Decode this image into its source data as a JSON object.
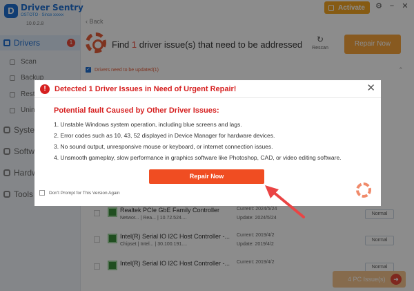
{
  "app": {
    "name": "Driver Sentry",
    "subtitle": "OSTOTO · Since xxxxx",
    "version": "10.0.2.8",
    "activate_label": "Activate"
  },
  "sidebar": {
    "drivers": {
      "label": "Drivers",
      "badge": "1"
    },
    "subitems": [
      {
        "label": "Scan"
      },
      {
        "label": "Backup"
      },
      {
        "label": "Rest"
      },
      {
        "label": "Unin"
      }
    ],
    "items": [
      {
        "label": "Systen"
      },
      {
        "label": "Softw"
      },
      {
        "label": "Hardw"
      },
      {
        "label": "Tools"
      }
    ]
  },
  "header": {
    "back_label": "Back",
    "find_prefix": "Find",
    "issue_count": "1",
    "find_suffix": "driver issue(s) that need to be addressed",
    "rescan_label": "Rescan",
    "repair_label": "Repair Now"
  },
  "section": {
    "label": "Drivers need to be updated(1)"
  },
  "rows": [
    {
      "name": "Realtek PCIe GbE Family Controller",
      "meta": "Networ... | Rea... | 10.72.524....",
      "current": "Current: 2024/5/24",
      "update": "Update: 2024/5/24",
      "status": "Normal"
    },
    {
      "name": "Intel(R) Serial IO I2C Host Controller -...",
      "meta": "Chipset | Intel... | 30.100.191....",
      "current": "Current: 2019/4/2",
      "update": "Update: 2019/4/2",
      "status": "Normal"
    },
    {
      "name": "Intel(R) Serial IO I2C Host Controller -...",
      "meta": "",
      "current": "Current: 2019/4/2",
      "update": "",
      "status": "Normal"
    }
  ],
  "pc_issue": {
    "label": "4 PC Issue(s)"
  },
  "dialog": {
    "title": "Detected 1 Driver Issues in Need of Urgent Repair!",
    "heading": "Potential fault Caused by Other Driver Issues:",
    "issues": [
      "1. Unstable Windows system operation, including blue screens and lags.",
      "2. Error codes such as 10, 43, 52 displayed in Device Manager for hardware devices.",
      "3. No sound output, unresponsive mouse or keyboard, or internet connection issues.",
      "4. Unsmooth gameplay, slow performance in graphics software like Photoshop, CAD, or video editing software."
    ],
    "repair_label": "Repair Now",
    "dont_prompt_label": "Don't Prompt for This Version Again"
  },
  "colors": {
    "brand_blue": "#1f6fd1",
    "alert_red": "#d62020",
    "repair_orange": "#f04d22",
    "activate_orange": "#f5a623"
  }
}
